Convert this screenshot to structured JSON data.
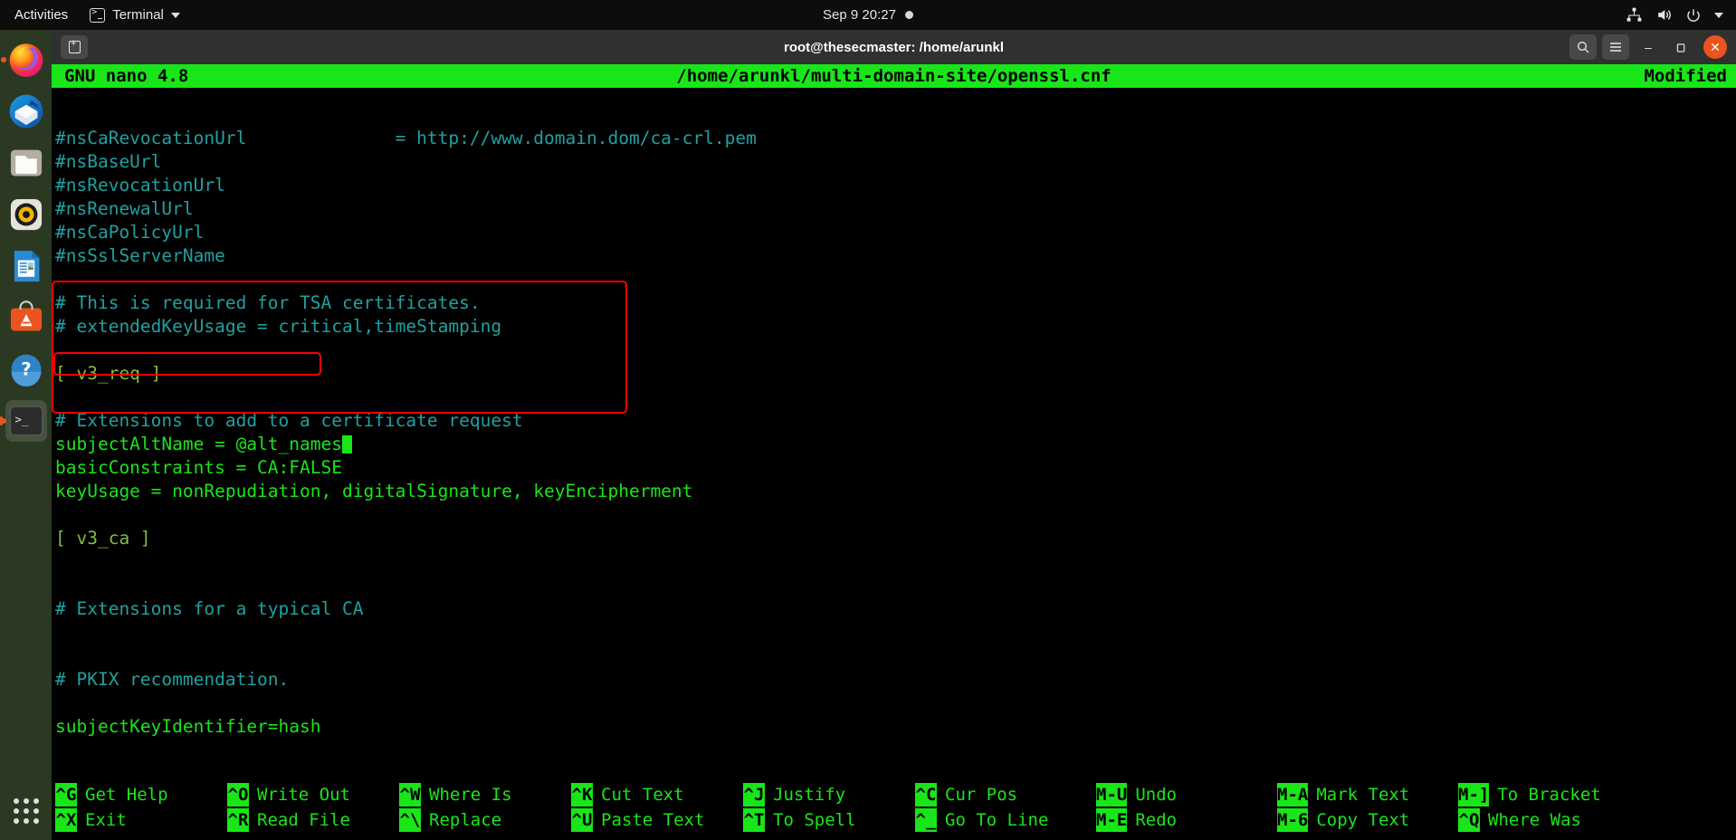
{
  "topbar": {
    "activities": "Activities",
    "app_name": "Terminal",
    "clock": "Sep 9  20:27",
    "icons": [
      "network-icon",
      "volume-icon",
      "power-icon",
      "chevron-down-icon"
    ]
  },
  "window": {
    "title": "root@thesecmaster: /home/arunkl",
    "new_tab_label": "+",
    "search_icon": "search-icon",
    "menu_icon": "hamburger-menu-icon",
    "minimize": "–",
    "maximize": "❐",
    "close": "✕"
  },
  "dock": {
    "items": [
      {
        "name": "firefox",
        "label": "Firefox Web Browser"
      },
      {
        "name": "thunderbird",
        "label": "Thunderbird Mail"
      },
      {
        "name": "files",
        "label": "Files"
      },
      {
        "name": "rhythmbox",
        "label": "Rhythmbox"
      },
      {
        "name": "libreoffice-writer",
        "label": "LibreOffice Writer"
      },
      {
        "name": "software",
        "label": "Ubuntu Software"
      },
      {
        "name": "help",
        "label": "Help"
      },
      {
        "name": "terminal",
        "label": "Terminal"
      }
    ],
    "show_apps": "Show Applications"
  },
  "nano": {
    "version": "GNU nano 4.8",
    "filename": "/home/arunkl/multi-domain-site/openssl.cnf",
    "status": "Modified",
    "lines": [
      {
        "t": "",
        "c": "cmt"
      },
      {
        "t": "#nsCaRevocationUrl              = http://www.domain.dom/ca-crl.pem",
        "c": "cmt"
      },
      {
        "t": "#nsBaseUrl",
        "c": "cmt"
      },
      {
        "t": "#nsRevocationUrl",
        "c": "cmt"
      },
      {
        "t": "#nsRenewalUrl",
        "c": "cmt"
      },
      {
        "t": "#nsCaPolicyUrl",
        "c": "cmt"
      },
      {
        "t": "#nsSslServerName",
        "c": "cmt"
      },
      {
        "t": "",
        "c": "cmt"
      },
      {
        "t": "# This is required for TSA certificates.",
        "c": "cmt"
      },
      {
        "t": "# extendedKeyUsage = critical,timeStamping",
        "c": "cmt"
      },
      {
        "t": "",
        "c": "cmt"
      },
      {
        "t": "[ v3_req ]",
        "c": "sect"
      },
      {
        "t": "",
        "c": "cmt"
      },
      {
        "t": "# Extensions to add to a certificate request",
        "c": "cmt"
      },
      {
        "t": "subjectAltName = @alt_names",
        "c": "key",
        "cursor": true
      },
      {
        "t": "basicConstraints = CA:FALSE",
        "c": "key"
      },
      {
        "t": "keyUsage = nonRepudiation, digitalSignature, keyEncipherment",
        "c": "key"
      },
      {
        "t": "",
        "c": "cmt"
      },
      {
        "t": "[ v3_ca ]",
        "c": "sect"
      },
      {
        "t": "",
        "c": "cmt"
      },
      {
        "t": "",
        "c": "cmt"
      },
      {
        "t": "# Extensions for a typical CA",
        "c": "cmt"
      },
      {
        "t": "",
        "c": "cmt"
      },
      {
        "t": "",
        "c": "cmt"
      },
      {
        "t": "# PKIX recommendation.",
        "c": "cmt"
      },
      {
        "t": "",
        "c": "cmt"
      },
      {
        "t": "subjectKeyIdentifier=hash",
        "c": "key"
      }
    ],
    "help_row1": [
      {
        "key": "^G",
        "label": "Get Help"
      },
      {
        "key": "^O",
        "label": "Write Out"
      },
      {
        "key": "^W",
        "label": "Where Is"
      },
      {
        "key": "^K",
        "label": "Cut Text"
      },
      {
        "key": "^J",
        "label": "Justify"
      },
      {
        "key": "^C",
        "label": "Cur Pos"
      },
      {
        "key": "M-U",
        "label": "Undo"
      },
      {
        "key": "M-A",
        "label": "Mark Text"
      },
      {
        "key": "M-]",
        "label": "To Bracket"
      }
    ],
    "help_row2": [
      {
        "key": "^X",
        "label": "Exit"
      },
      {
        "key": "^R",
        "label": "Read File"
      },
      {
        "key": "^\\",
        "label": "Replace"
      },
      {
        "key": "^U",
        "label": "Paste Text"
      },
      {
        "key": "^T",
        "label": "To Spell"
      },
      {
        "key": "^_",
        "label": "Go To Line"
      },
      {
        "key": "M-E",
        "label": "Redo"
      },
      {
        "key": "M-6",
        "label": "Copy Text"
      },
      {
        "key": "^Q",
        "label": "Where Was"
      }
    ]
  },
  "annotations": {
    "outer_box_color": "#ff0000",
    "inner_box_color": "#ff0000",
    "outer_box_target": "v3_req-section",
    "inner_box_target": "subjectAltName-line"
  },
  "colors": {
    "nano_header_bg": "#19e619",
    "comment": "#21a0a0",
    "section": "#7fbf3f",
    "key": "#19e619",
    "accent": "#e95420"
  }
}
